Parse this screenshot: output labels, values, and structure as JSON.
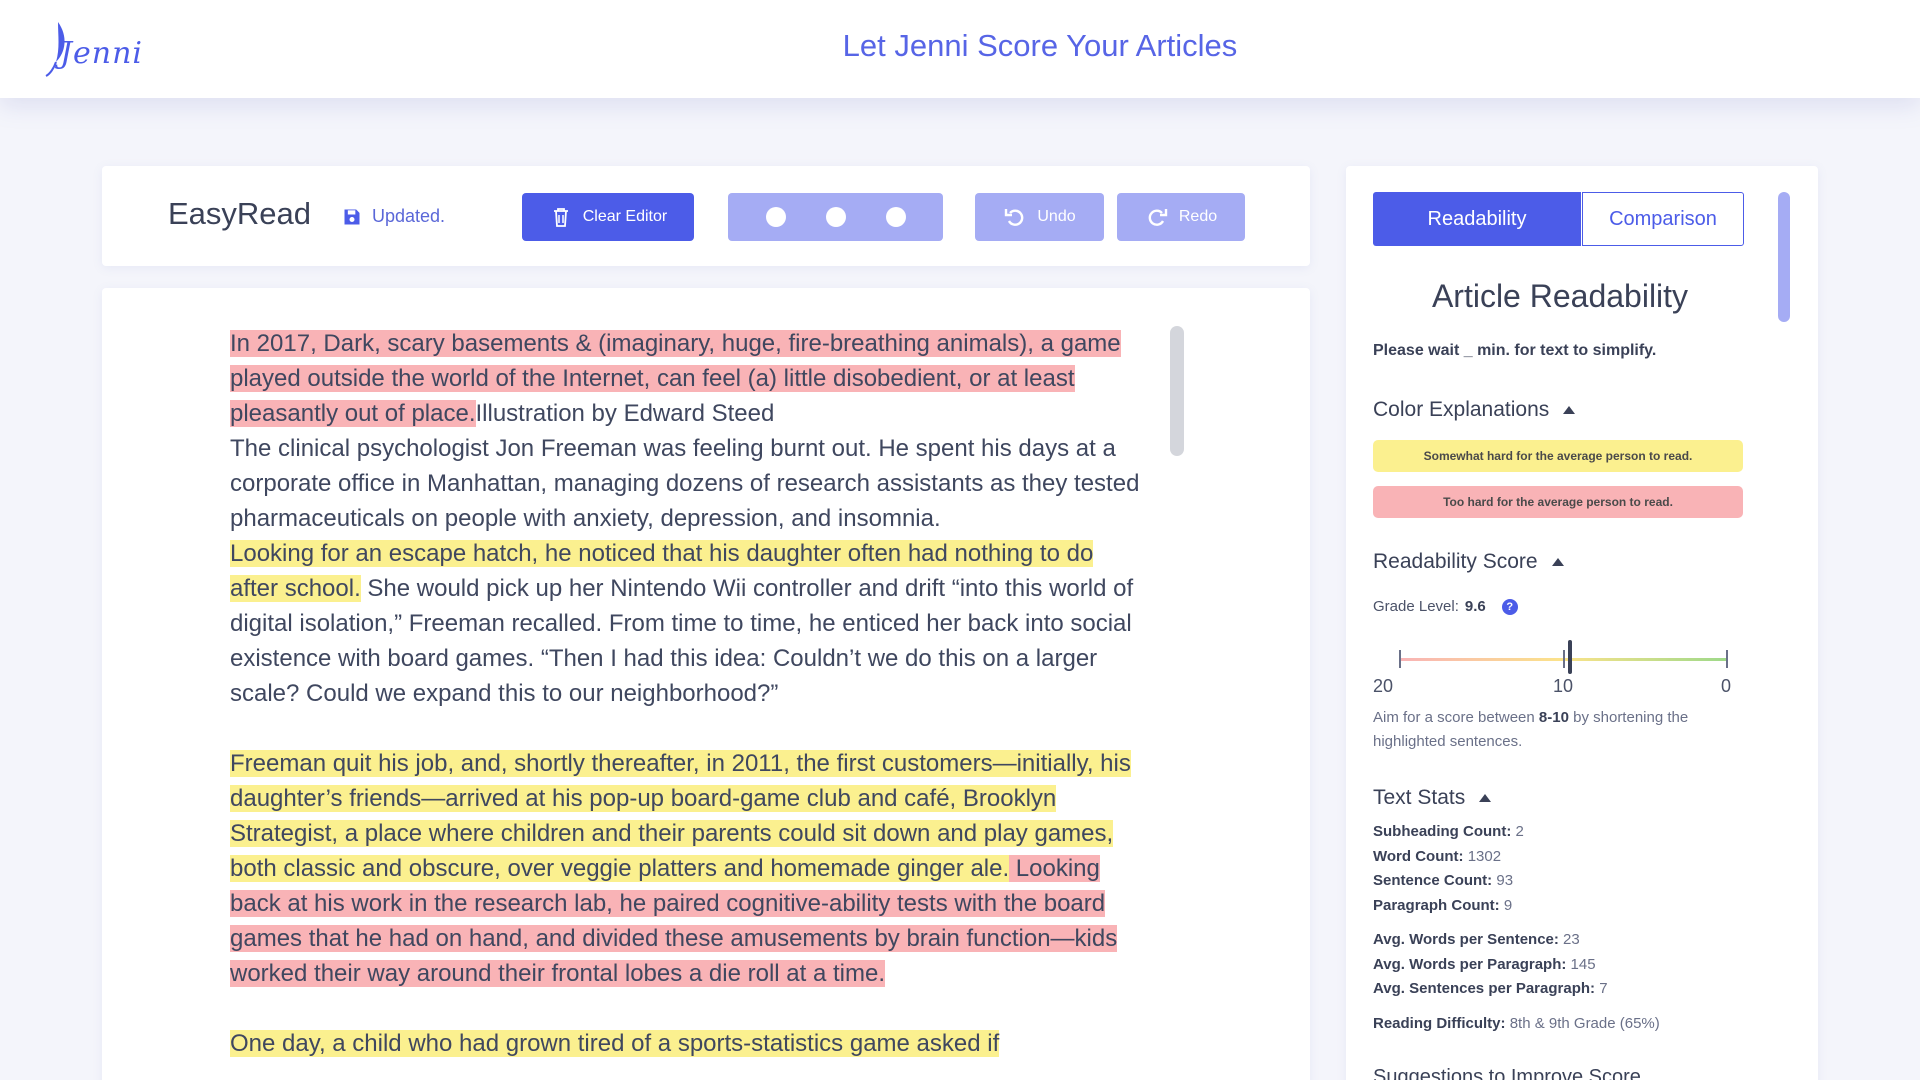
{
  "header": {
    "logo_text": "Jenni",
    "title": "Let Jenni Score Your Articles"
  },
  "toolbar": {
    "doc_name": "EasyRead",
    "save_status": "Updated.",
    "clear_label": "Clear Editor",
    "undo_label": "Undo",
    "redo_label": "Redo"
  },
  "editor": {
    "paragraphs": [
      {
        "segments": [
          {
            "text": "In 2017, Dark, scary basements & (imaginary, huge, fire-breathing animals), a game played outside the world of the Internet, can feel (a) little disobedient, or at least pleasantly out of place.",
            "highlight": "red"
          },
          {
            "text": "Illustration by Edward Steed",
            "highlight": "none",
            "break_after": true
          },
          {
            "text": "The clinical psychologist Jon Freeman was feeling burnt out. He spent his days at a corporate office in Manhattan, managing dozens of research assistants as they tested pharmaceuticals on people with anxiety, depression, and insomnia.",
            "highlight": "none",
            "break_after": true
          },
          {
            "text": "Looking for an escape hatch, he noticed that his daughter often had nothing to do after school.",
            "highlight": "yellow"
          },
          {
            "text": " She would pick up her Nintendo Wii controller and drift “into this world of digital isolation,” Freeman recalled. From time to time, he enticed her back into social existence with board games. “Then I had this idea: Couldn’t we do this on a larger scale? Could we expand this to our neighborhood?”",
            "highlight": "none"
          }
        ]
      },
      {
        "segments": [
          {
            "text": "Freeman quit his job, and, shortly thereafter, in 2011, the first customers—initially, his daughter’s friends—arrived at his pop-up board-game club and café, Brooklyn Strategist, a place where children and their parents could sit down and play games, both classic and obscure, over veggie platters and homemade ginger ale.",
            "highlight": "yellow"
          },
          {
            "text": " Looking back at his work in the research lab, he paired cognitive-ability tests with the board games that he had on hand, and divided these amusements by brain function—kids worked their way around their frontal lobes a die roll at a time.",
            "highlight": "red"
          }
        ]
      },
      {
        "segments": [
          {
            "text": "One day, a child who had grown tired of a sports-statistics game asked if",
            "highlight": "yellow"
          }
        ]
      }
    ]
  },
  "panel": {
    "tab_readability": "Readability",
    "tab_comparison": "Comparison",
    "title": "Article Readability",
    "wait_note": "Please wait _ min. for text to simplify.",
    "color_heading": "Color Explanations",
    "legend_yellow": "Somewhat hard for the average person to read.",
    "legend_red": "Too hard for the average person to read.",
    "score_heading": "Readability Score",
    "grade_label": "Grade Level:",
    "grade_value": "9.6",
    "grade_level": 9.6,
    "scale_left": "20",
    "scale_mid": "10",
    "scale_right": "0",
    "aim_prefix": "Aim for a score between ",
    "aim_range": "8-10",
    "aim_suffix": " by shortening the highlighted sentences.",
    "stats_heading": "Text Stats",
    "stats_group1": [
      {
        "label": "Subheading Count:",
        "value": "2"
      },
      {
        "label": "Word Count:",
        "value": "1302"
      },
      {
        "label": "Sentence Count:",
        "value": "93"
      },
      {
        "label": "Paragraph Count:",
        "value": "9"
      }
    ],
    "stats_group2": [
      {
        "label": "Avg. Words per Sentence:",
        "value": "23"
      },
      {
        "label": "Avg. Words per Paragraph:",
        "value": "145"
      },
      {
        "label": "Avg. Sentences per Paragraph:",
        "value": "7"
      }
    ],
    "difficulty_label": "Reading Difficulty:",
    "difficulty_value": "8th & 9th Grade (65%)",
    "suggestions_heading": "Suggestions to Improve Score"
  },
  "colors": {
    "accent": "#4c5ce8",
    "accent_light": "#a5acf4",
    "highlight_red": "#f9b3b6",
    "highlight_yellow": "#fbf08f"
  }
}
